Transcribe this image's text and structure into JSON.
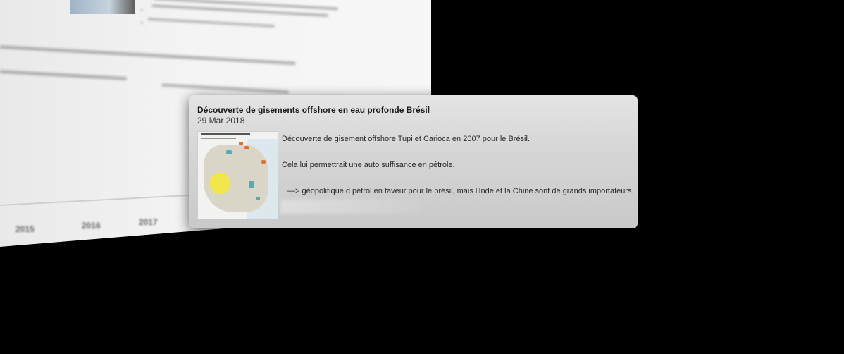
{
  "card": {
    "title": "Découverte de gisements offshore en eau profonde Brésil",
    "date": "29 Mar 2018",
    "paragraphs": [
      "Découverte de gisement offshore Tupi et Carioca en 2007 pour le Brésil.",
      "Cela lui permettrait une auto suffisance en pétrole.",
      "—> géopolitique d pétrol en faveur pour le brésil, mais l'Inde et la Chine sont de grands importateurs."
    ]
  },
  "background_timeline": {
    "years": [
      "2015",
      "2016",
      "2017"
    ]
  },
  "colors": {
    "background": "#000000",
    "card": "#d6d6d6",
    "map_highlight": "#f1e64a",
    "map_marker": "#e0702a",
    "map_field": "#5aa7b8"
  }
}
